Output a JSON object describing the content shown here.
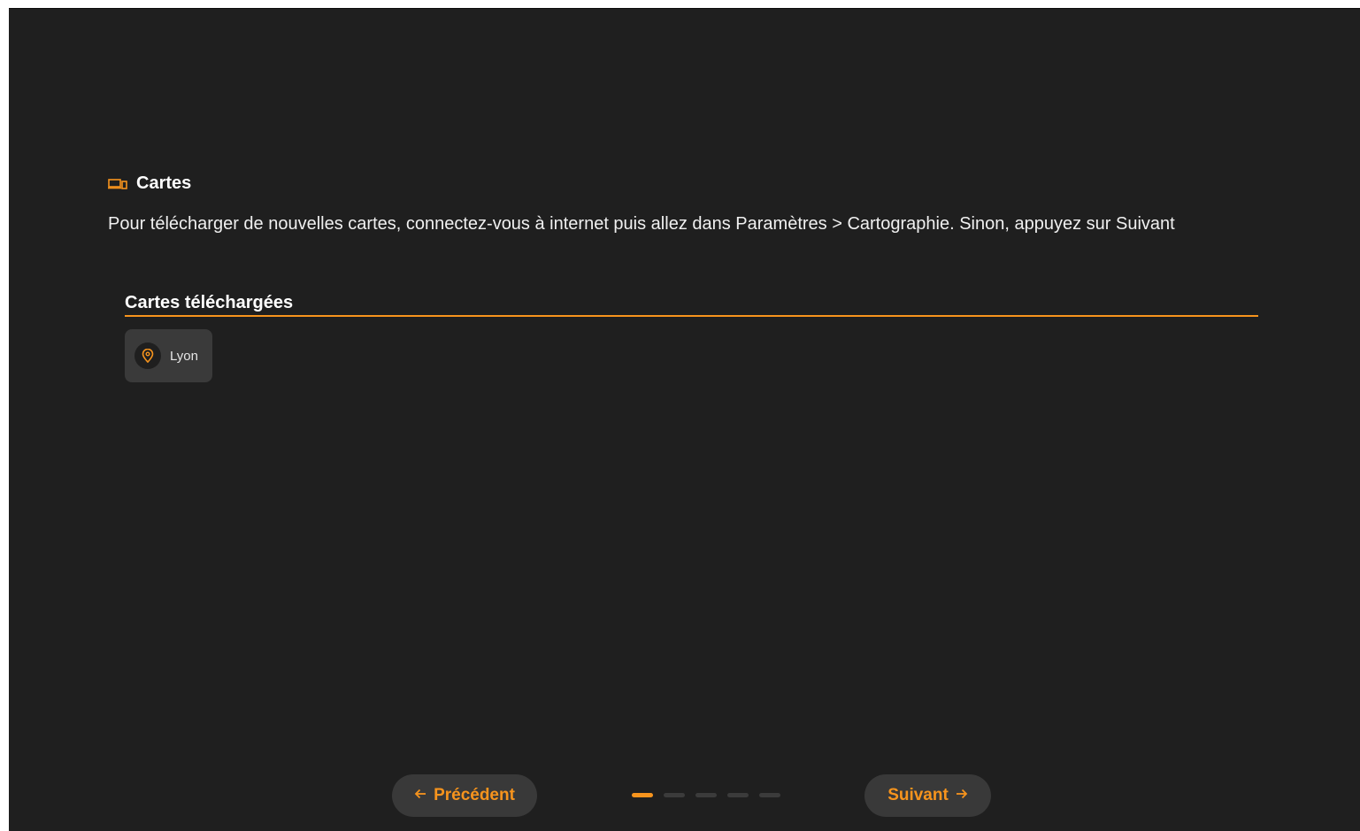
{
  "section": {
    "icon": "devices-icon",
    "title": "Cartes"
  },
  "description": "Pour télécharger de nouvelles cartes, connectez-vous à internet puis allez dans Paramètres > Cartographie. Sinon, appuyez sur Suivant",
  "downloaded_maps": {
    "header": "Cartes téléchargées",
    "items": [
      {
        "label": "Lyon",
        "icon": "map-pin-icon"
      }
    ]
  },
  "footer": {
    "prev_label": "Précédent",
    "next_label": "Suivant",
    "prev_icon": "arrow-left-icon",
    "next_icon": "arrow-right-icon",
    "steps_total": 5,
    "active_step": 1
  },
  "colors": {
    "accent": "#f7941d",
    "background": "#1f1f1f",
    "surface": "#3a3a3a"
  }
}
